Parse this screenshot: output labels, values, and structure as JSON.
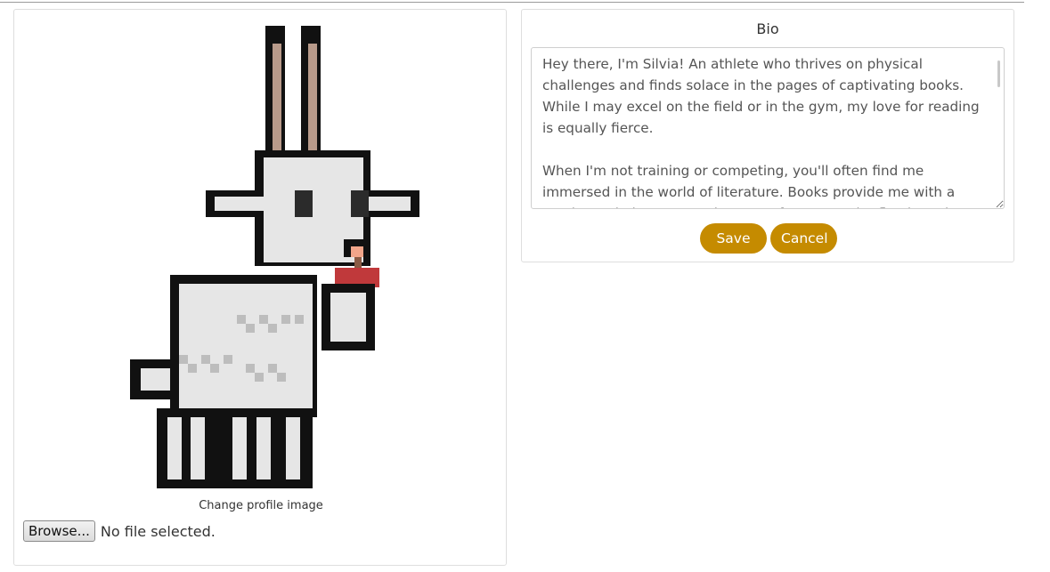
{
  "profile": {
    "change_image_label": "Change profile image",
    "browse_button_label": "Browse...",
    "file_status": "No file selected."
  },
  "bio": {
    "title": "Bio",
    "text": "Hey there, I'm Silvia! An athlete who thrives on physical challenges and finds solace in the pages of captivating books. While I may excel on the field or in the gym, my love for reading is equally fierce.\n\nWhen I'm not training or competing, you'll often find me immersed in the world of literature. Books provide me with a much-needed escape and a space for personal reflection. They offer a different kind",
    "save_label": "Save",
    "cancel_label": "Cancel"
  },
  "colors": {
    "accent": "#c58b00",
    "goat_body": "#e6e6e6",
    "goat_outline": "#111111",
    "ear_inner": "#b89a8a",
    "nose": "#f2a58a",
    "mouth": "#c0393b"
  }
}
